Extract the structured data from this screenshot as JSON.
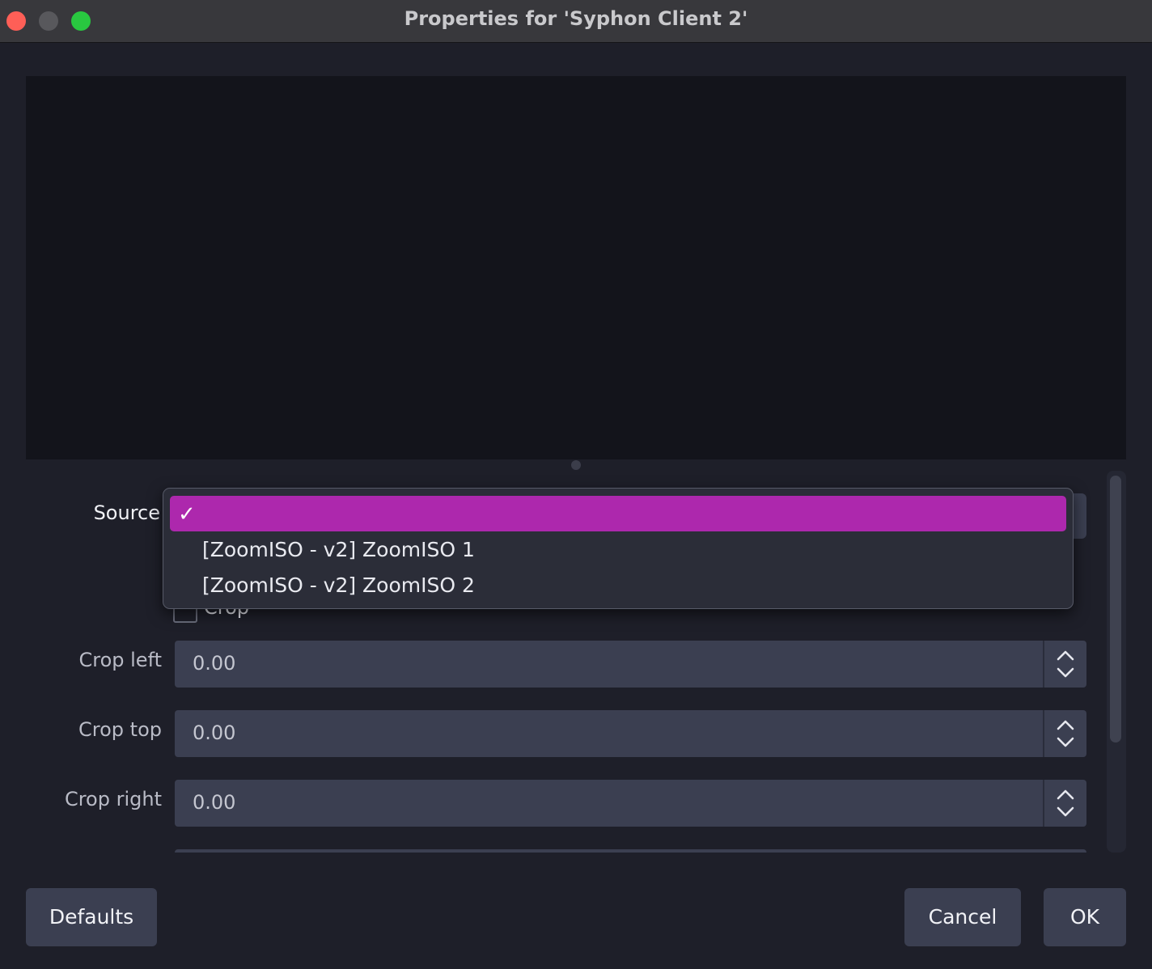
{
  "window": {
    "title": "Properties for 'Syphon Client 2'"
  },
  "properties": {
    "source_label": "Source",
    "crop_checkbox_label": "Crop",
    "crop_checked": false,
    "fields": [
      {
        "label": "Crop left",
        "value": "0.00"
      },
      {
        "label": "Crop top",
        "value": "0.00"
      },
      {
        "label": "Crop right",
        "value": "0.00"
      }
    ]
  },
  "dropdown": {
    "check_glyph": "✓",
    "options": [
      {
        "label": "",
        "selected": true
      },
      {
        "label": "[ZoomISO - v2] ZoomISO 1",
        "selected": false
      },
      {
        "label": "[ZoomISO - v2] ZoomISO 2",
        "selected": false
      }
    ]
  },
  "buttons": {
    "defaults": "Defaults",
    "cancel": "Cancel",
    "ok": "OK"
  },
  "colors": {
    "accent": "#ad28ad",
    "background": "#1e1f29",
    "control": "#3b3f51"
  },
  "icons": [
    "close-window-icon",
    "minimize-window-icon",
    "maximize-window-icon",
    "checkmark-icon",
    "chevron-up-icon",
    "chevron-down-icon"
  ]
}
